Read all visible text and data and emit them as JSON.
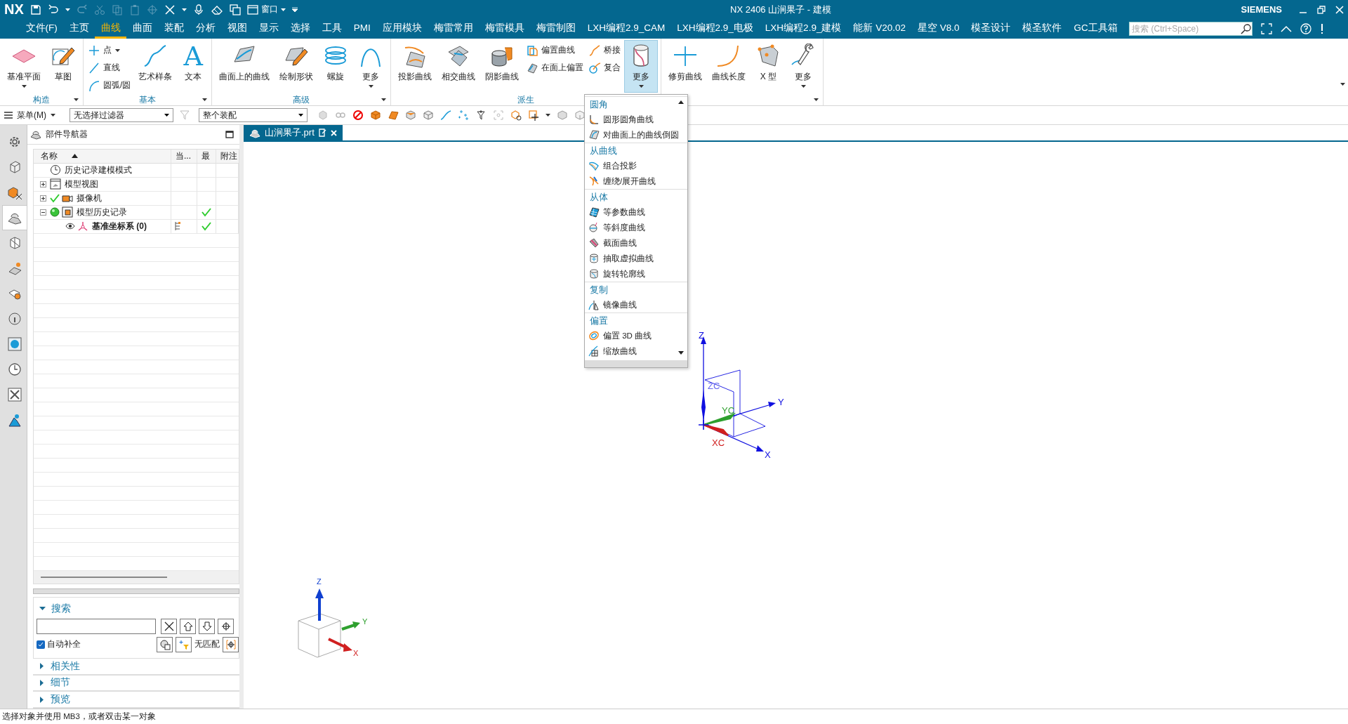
{
  "title_bar": {
    "logo": "NX",
    "window_menu": "窗口",
    "title": "NX 2406 山涧果子 - 建模",
    "brand": "SIEMENS"
  },
  "menu_bar": {
    "tabs": [
      {
        "label": "文件(F)",
        "selected": false
      },
      {
        "label": "主页",
        "selected": false
      },
      {
        "label": "曲线",
        "selected": true
      },
      {
        "label": "曲面",
        "selected": false
      },
      {
        "label": "装配",
        "selected": false
      },
      {
        "label": "分析",
        "selected": false
      },
      {
        "label": "视图",
        "selected": false
      },
      {
        "label": "显示",
        "selected": false
      },
      {
        "label": "选择",
        "selected": false
      },
      {
        "label": "工具",
        "selected": false
      },
      {
        "label": "PMI",
        "selected": false
      },
      {
        "label": "应用模块",
        "selected": false
      },
      {
        "label": "梅雷常用",
        "selected": false
      },
      {
        "label": "梅雷模具",
        "selected": false
      },
      {
        "label": "梅雷制图",
        "selected": false
      },
      {
        "label": "LXH编程2.9_CAM",
        "selected": false
      },
      {
        "label": "LXH编程2.9_电极",
        "selected": false
      },
      {
        "label": "LXH编程2.9_建模",
        "selected": false
      },
      {
        "label": "能新 V20.02",
        "selected": false
      },
      {
        "label": "星空 V8.0",
        "selected": false
      },
      {
        "label": "模圣设计",
        "selected": false
      },
      {
        "label": "模圣软件",
        "selected": false
      },
      {
        "label": "GC工具箱",
        "selected": false
      }
    ],
    "search": {
      "placeholder": "搜索 (Ctrl+Space)"
    }
  },
  "ribbon": {
    "groups": [
      {
        "label": "构造",
        "tools": [
          {
            "kind": "large",
            "label": "基准平面",
            "caret": true,
            "pressed": false
          },
          {
            "kind": "large",
            "label": "草图",
            "caret": false,
            "pressed": false
          }
        ]
      },
      {
        "label": "基本",
        "tools": [
          {
            "kind": "stack",
            "items": [
              {
                "label": "点",
                "caret": true
              },
              {
                "label": "直线",
                "caret": false
              },
              {
                "label": "圆弧/圆",
                "caret": false
              }
            ]
          },
          {
            "kind": "large",
            "label": "艺术样条",
            "caret": false,
            "pressed": false
          },
          {
            "kind": "glyph",
            "glyph": "A",
            "label": "文本",
            "caret": false,
            "pressed": false
          }
        ]
      },
      {
        "label": "高级",
        "tools": [
          {
            "kind": "large",
            "label": "曲面上的曲线",
            "caret": false,
            "pressed": false
          },
          {
            "kind": "large",
            "label": "绘制形状",
            "caret": false,
            "pressed": false
          },
          {
            "kind": "large",
            "label": "螺旋",
            "caret": false,
            "pressed": false
          },
          {
            "kind": "large",
            "label": "更多",
            "caret": true,
            "pressed": false
          }
        ]
      },
      {
        "label": "派生",
        "tools": [
          {
            "kind": "large",
            "label": "投影曲线",
            "caret": false,
            "pressed": false
          },
          {
            "kind": "large",
            "label": "相交曲线",
            "caret": false,
            "pressed": false
          },
          {
            "kind": "large",
            "label": "阴影曲线",
            "caret": false,
            "pressed": false
          },
          {
            "kind": "stack",
            "items": [
              {
                "label": "偏置曲线",
                "caret": false
              },
              {
                "label": "在面上偏置",
                "caret": false
              }
            ]
          },
          {
            "kind": "stack",
            "items": [
              {
                "label": "桥接",
                "caret": false
              },
              {
                "label": "复合",
                "caret": false
              }
            ]
          },
          {
            "kind": "large",
            "label": "更多",
            "caret": true,
            "pressed": true
          }
        ]
      },
      {
        "tools": [
          {
            "kind": "large",
            "label": "修剪曲线",
            "caret": false,
            "pressed": false
          },
          {
            "kind": "large",
            "label": "曲线长度",
            "caret": false,
            "pressed": false
          },
          {
            "kind": "large",
            "label": "X 型",
            "caret": false,
            "pressed": false
          },
          {
            "kind": "large",
            "label": "更多",
            "caret": true,
            "pressed": false
          }
        ]
      }
    ]
  },
  "toolbar": {
    "menu_button": "菜单(M)",
    "selection_filter": "无选择过滤器",
    "scope": "整个装配"
  },
  "resource_bar": [
    {
      "selected": false
    },
    {
      "selected": false
    },
    {
      "selected": false
    },
    {
      "selected": true
    },
    {
      "selected": false
    },
    {
      "selected": false
    },
    {
      "selected": false
    },
    {
      "selected": false
    },
    {
      "selected": false
    },
    {
      "selected": false
    },
    {
      "selected": false
    },
    {
      "selected": false
    }
  ],
  "part_navigator": {
    "title": "部件导航器",
    "columns": [
      {
        "label": "名称",
        "sorted": true
      },
      {
        "label": "当...",
        "sorted": false
      },
      {
        "label": "最",
        "sorted": false
      },
      {
        "label": "附注",
        "sorted": false
      }
    ],
    "rows": [
      {
        "label": "历史记录建模模式",
        "checked": false,
        "latest": false,
        "bold": false
      },
      {
        "label": "模型视图",
        "expanded": false,
        "checked": false,
        "latest": false,
        "bold": false
      },
      {
        "label": "摄像机",
        "expanded": false,
        "checked": true,
        "latest": false,
        "bold": false
      },
      {
        "label": "模型历史记录",
        "expanded": true,
        "checked": false,
        "latest": true,
        "bold": false,
        "children": [
          {
            "label": "基准坐标系 (0)",
            "checked": false,
            "latest": true,
            "bold": true,
            "visible": true
          }
        ]
      }
    ],
    "search": {
      "title": "搜索",
      "expanded": true,
      "autocomplete": {
        "label": "自动补全",
        "checked": true
      },
      "status": "无匹配"
    },
    "sections": [
      {
        "label": "相关性",
        "expanded": false
      },
      {
        "label": "细节",
        "expanded": false
      },
      {
        "label": "预览",
        "expanded": false
      }
    ]
  },
  "viewport": {
    "tab": {
      "label": "山涧果子.prt",
      "selected": true
    },
    "csys_labels": {
      "z": "Z",
      "zc": "ZC",
      "yc": "YC",
      "y": "Y",
      "xc": "XC",
      "x": "X"
    },
    "triad_labels": {
      "z": "Z",
      "y": "Y",
      "x": "X"
    }
  },
  "more_menu": {
    "sections": [
      {
        "title": "圆角",
        "items": [
          "圆形圆角曲线",
          "对曲面上的曲线倒圆"
        ]
      },
      {
        "title": "从曲线",
        "items": [
          "组合投影",
          "缠绕/展开曲线"
        ]
      },
      {
        "title": "从体",
        "items": [
          "等参数曲线",
          "等斜度曲线",
          "截面曲线",
          "抽取虚拟曲线",
          "旋转轮廓线"
        ]
      },
      {
        "title": "复制",
        "items": [
          "镜像曲线"
        ]
      },
      {
        "title": "偏置",
        "items": [
          "偏置 3D 曲线",
          "缩放曲线"
        ]
      }
    ]
  },
  "status_bar": "选择对象并使用 MB3，或者双击某一对象"
}
